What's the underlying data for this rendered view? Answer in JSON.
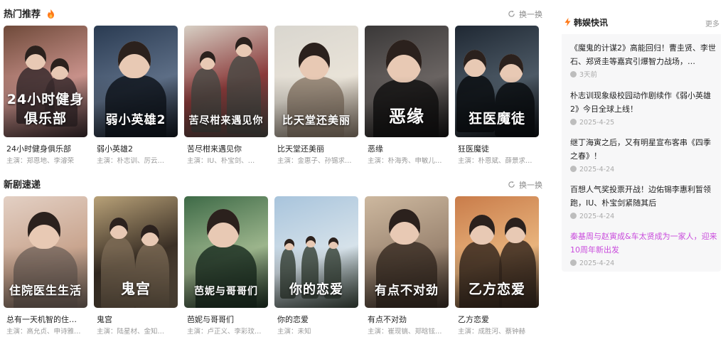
{
  "sections": [
    {
      "title": "热门推荐",
      "refresh": "换一换",
      "items": [
        {
          "name": "24小时健身俱乐部",
          "cast": "主演：郑恩地、李濬荣",
          "poster_text": "24小时健身俱乐部",
          "colors": [
            "#6f4a3a",
            "#c8918a",
            "#3a2b2e"
          ]
        },
        {
          "name": "弱小英雄2",
          "cast": "主演：朴志训、厉云…",
          "poster_text": "弱小英雄2",
          "colors": [
            "#2a3b52",
            "#5d6e86",
            "#11161f"
          ]
        },
        {
          "name": "苦尽柑来遇见你",
          "cast": "主演：IU、朴宝剑、…",
          "poster_text": "苦尽柑来遇见你",
          "colors": [
            "#d7cfc4",
            "#8a3a3a",
            "#4b4a45"
          ]
        },
        {
          "name": "比天堂还美丽",
          "cast": "主演：金惠子、孙锡求…",
          "poster_text": "比天堂还美丽",
          "colors": [
            "#d9d6cf",
            "#e9e3d8",
            "#8f7f6f"
          ]
        },
        {
          "name": "恶缘",
          "cast": "主演：朴海秀、申敏儿…",
          "poster_text": "恶缘",
          "colors": [
            "#3a3838",
            "#6a6462",
            "#141313"
          ]
        },
        {
          "name": "狂医魔徒",
          "cast": "主演：朴恩斌、薛景求…",
          "poster_text": "狂医魔徒",
          "colors": [
            "#1f2833",
            "#4d5a66",
            "#0b0e12"
          ]
        }
      ]
    },
    {
      "title": "新剧速递",
      "refresh": "换一换",
      "items": [
        {
          "name": "总有一天机智的住…",
          "cast": "主演：高允贞、申诗雅…",
          "poster_text": "住院医生生活",
          "colors": [
            "#e3d0c4",
            "#c9a58f",
            "#7a6a60"
          ]
        },
        {
          "name": "鬼宫",
          "cast": "主演：陆星材、金知…",
          "poster_text": "鬼宫",
          "colors": [
            "#b8a178",
            "#3a2f25",
            "#7b6a55"
          ]
        },
        {
          "name": "芭妮与哥哥们",
          "cast": "主演：卢正义、李彩玟…",
          "poster_text": "芭妮与哥哥们",
          "colors": [
            "#3e6a47",
            "#9cb58c",
            "#1f3325"
          ]
        },
        {
          "name": "你的恋爱",
          "cast": "主演：未知",
          "poster_text": "你的恋爱",
          "colors": [
            "#a8c4dc",
            "#d6e2ea",
            "#3e4a3f"
          ]
        },
        {
          "name": "有点不对劲",
          "cast": "主演：崔现镐、郑晗铉…",
          "poster_text": "有点不对劲",
          "colors": [
            "#cdb89f",
            "#9c8672",
            "#3c2f26"
          ]
        },
        {
          "name": "乙方恋爱",
          "cast": "主演：成胜河、蔡钟赫",
          "poster_text": "乙方恋爱",
          "colors": [
            "#c97c4a",
            "#e8b37c",
            "#3a2a20"
          ]
        }
      ]
    }
  ],
  "sidebar": {
    "title": "韩娱快讯",
    "more": "更多",
    "news": [
      {
        "text": "《魔鬼的计谋2》高能回归！曹圭贤、李世石、郑贤圭等嘉宾引爆智力战场，…",
        "date": "3天前",
        "highlight": false
      },
      {
        "text": "朴志训现象级校园动作剧续作《弱小英雄2》今日全球上线！",
        "date": "2025-4-25",
        "highlight": false
      },
      {
        "text": "继丁海寅之后，又有明星宣布客串《四季之春》！",
        "date": "2025-4-24",
        "highlight": false
      },
      {
        "text": "百想人气奖投票开战！边佑锡李惠利暂领跑，IU、朴宝剑紧随其后",
        "date": "2025-4-24",
        "highlight": false
      },
      {
        "text": "秦基周与赵寅成&车太贤成为一家人，迎来10周年新出发",
        "date": "2025-4-24",
        "highlight": true
      }
    ]
  },
  "colors": {
    "accent_fire": "#ff7a1a",
    "highlight_news": "#c94cdc"
  }
}
